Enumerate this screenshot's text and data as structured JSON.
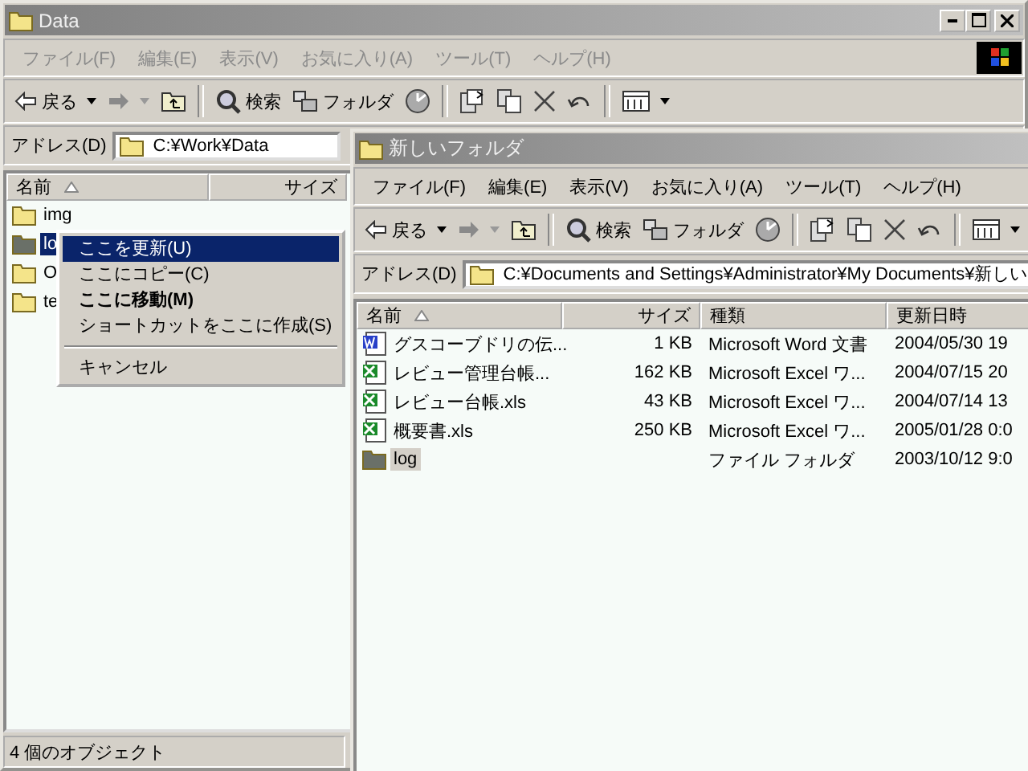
{
  "windows": [
    {
      "title": "Data",
      "menu": [
        "ファイル(F)",
        "編集(E)",
        "表示(V)",
        "お気に入り(A)",
        "ツール(T)",
        "ヘルプ(H)"
      ],
      "toolbar": {
        "back": "戻る",
        "search": "検索",
        "folders": "フォルダ"
      },
      "address": {
        "label": "アドレス(D)",
        "value": "C:¥Work¥Data"
      },
      "columns": [
        {
          "label": "名前",
          "sorted": true
        },
        {
          "label": "サイズ",
          "sorted": false
        }
      ],
      "rows": [
        {
          "cells": [
            "img"
          ],
          "kind": "folder",
          "selected": false
        },
        {
          "cells": [
            "lo"
          ],
          "kind": "folder",
          "selected": true
        },
        {
          "cells": [
            "O"
          ],
          "kind": "folder",
          "selected": false
        },
        {
          "cells": [
            "te"
          ],
          "kind": "folder",
          "selected": false
        }
      ],
      "status_bar": "4 個のオブジェクト"
    },
    {
      "title": "新しいフォルダ",
      "menu": [
        "ファイル(F)",
        "編集(E)",
        "表示(V)",
        "お気に入り(A)",
        "ツール(T)",
        "ヘルプ(H)"
      ],
      "toolbar": {
        "back": "戻る",
        "search": "検索",
        "folders": "フォルダ"
      },
      "address": {
        "label": "アドレス(D)",
        "value": "C:¥Documents and Settings¥Administrator¥My Documents¥新しい"
      },
      "columns": [
        {
          "label": "名前",
          "sorted": true
        },
        {
          "label": "サイズ",
          "sorted": false
        },
        {
          "label": "種類",
          "sorted": false
        },
        {
          "label": "更新日時",
          "sorted": false
        }
      ],
      "rows": [
        {
          "cells": [
            "グスコーブドリの伝...",
            "1 KB",
            "Microsoft Word 文書",
            "2004/05/30 19"
          ],
          "kind": "word",
          "selected": false
        },
        {
          "cells": [
            "レビュー管理台帳...",
            "162 KB",
            "Microsoft Excel ワ...",
            "2004/07/15 20"
          ],
          "kind": "excel",
          "selected": false
        },
        {
          "cells": [
            "レビュー台帳.xls",
            "43 KB",
            "Microsoft Excel ワ...",
            "2004/07/14 13"
          ],
          "kind": "excel",
          "selected": false
        },
        {
          "cells": [
            "概要書.xls",
            "250 KB",
            "Microsoft Excel ワ...",
            "2005/01/28 0:0"
          ],
          "kind": "excel",
          "selected": false
        },
        {
          "cells": [
            "log",
            "",
            "ファイル フォルダ",
            "2003/10/12 9:0"
          ],
          "kind": "folder",
          "selected": true
        }
      ]
    }
  ],
  "context_menu": {
    "items": [
      {
        "kind": "item",
        "label": "ここを更新(U)",
        "selected": true,
        "bold": false
      },
      {
        "kind": "item",
        "label": "ここにコピー(C)",
        "selected": false,
        "bold": false
      },
      {
        "kind": "item",
        "label": "ここに移動(M)",
        "selected": false,
        "bold": true
      },
      {
        "kind": "item",
        "label": "ショートカットをここに作成(S)",
        "selected": false,
        "bold": false
      },
      {
        "kind": "separator"
      },
      {
        "kind": "item",
        "label": "キャンセル",
        "selected": false,
        "bold": false
      }
    ]
  }
}
